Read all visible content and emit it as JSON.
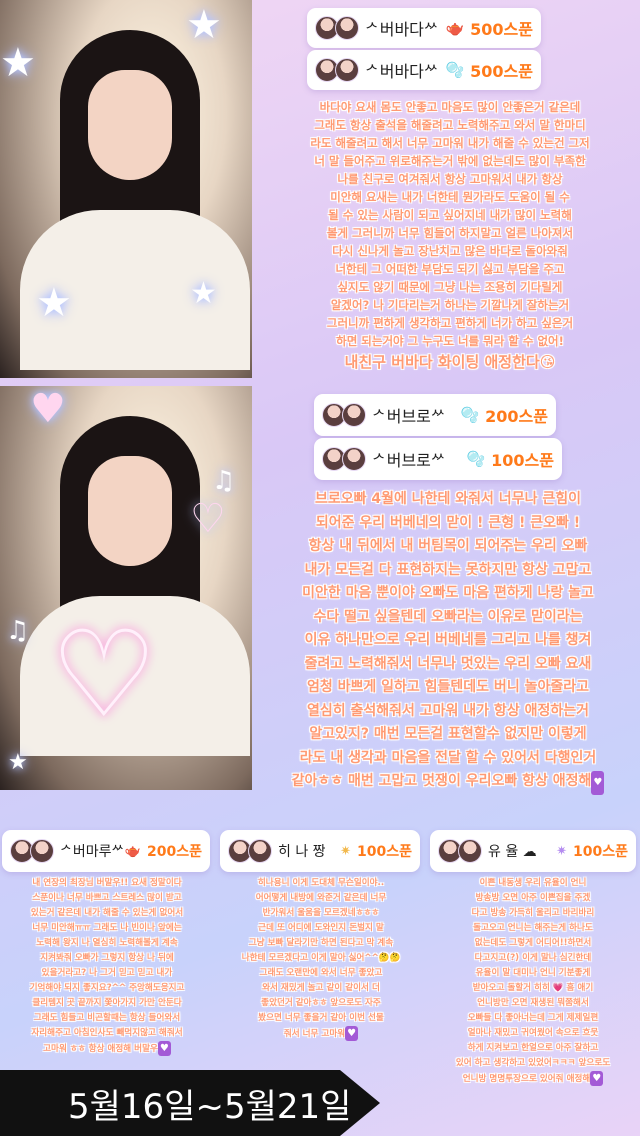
{
  "cards": [
    {
      "name": "ᄼ버바다ᄽ",
      "icon": "🫖",
      "amount": "500스푼"
    },
    {
      "name": "ᄼ버바다ᄽ",
      "icon": "🫧",
      "amount": "500스푼"
    },
    {
      "name": "ᄼ버브로ᄽ",
      "icon": "🫧",
      "amount": "200스푼"
    },
    {
      "name": "ᄼ버브로ᄽ",
      "icon": "🫧",
      "amount": "100스푼"
    },
    {
      "name": "ᄼ버마루ᄽ",
      "icon": "🫖",
      "amount": "200스푼"
    },
    {
      "name": "히 나 짱",
      "icon": "✷",
      "amount": "100스푼"
    },
    {
      "name": "유 율 ☁",
      "icon": "✷",
      "amount": "100스푼"
    }
  ],
  "messages": {
    "bada": [
      "바다야 요새 몸도 안좋고 마음도 많이 안좋은거 같은데",
      "그래도 항상 출석을 해줄려고 노력해주고 와서 말 한마디",
      "라도 해줄려고 해서 너무 고마워 내가 해줄 수 있는건 그저",
      "너 말 들어주고 위로해주는거 밖에 없는데도 많이 부족한",
      "나를 친구로 여겨줘서 항상 고마워서 내가 항상",
      "미안해 요새는 내가 너한테 뭔가라도 도움이 될 수",
      "될 수 있는 사람이 되고 싶어지네 내가 많이 노력해",
      "볼게 그러니까 너무 힘들어 하지말고 얼른 나아져서",
      "다시 신나게 놀고 장난치고 많은 바다로 돌아와줘",
      "너한테 그 어떠한 부담도 되기 싫고 부담을 주고",
      "싶지도 않기 때문에 그냥 나는 조용히 기다릴게",
      "알겠어? 나 기다리는거 하나는 기깔나게 잘하는거",
      "그러니까 편하게 생각하고 편하게 너가 하고 싶은거",
      "하면 되는거야 그 누구도 너를 뭐라 할 수 없어!",
      "내친구 버바다 화이팅 애정한다😘"
    ],
    "bro": [
      "브로오빠 4월에 나한테 와줘서 너무나 큰힘이",
      "되어준 우리 버베네의 맏이 ! 큰형 ! 큰오빠 !",
      "항상 내 뒤에서 내 버팀목이 되어주는 우리 오빠",
      "내가 모든걸 다 표현하지는 못하지만 항상 고맙고",
      "미안한 마음 뿐이야 오빠도 마음 편하게 나랑 놀고",
      "수다 떨고 싶을텐데 오빠라는 이유로 맏이라는",
      "이유 하나만으로 우리 버베네를 그리고 나를 챙겨",
      "줄려고 노력해줘서 너무나 멋있는 우리 오빠 요새",
      "엄청 바쁘게 일하고 힘들텐데도 버니 놀아줄라고",
      "열심히 출석해줘서 고마워 내가 항상 애정하는거",
      "알고있지? 매번 모든걸 표현할수 없지만 이렇게",
      "라도 내 생각과 마음을 전달 할 수 있어서 다행인거",
      "같아ㅎㅎ 매번 고맙고 멋쟁이 우리오빠 항상 애정해"
    ],
    "maru": [
      "내 연장의 최장님 버말우!! 요새 정말이다",
      "스푼이나 너무 바쁘고 스트레스 많이 받고",
      "있는거 같은데 내가 해줄 수 있는게 없어서",
      "너무 미안해ㅠㅠ 그래도 나 빈이나 앞에는",
      "노력해 왕지 나 열심히 노력해볼게 계속",
      "지켜봐줘 오빠가 그렇지 항상 나 뒤에",
      "있을거라고? 나 그거 믿고 믿고 내가",
      "기억해야 되지 좋지요?^^ 주앙해도응지고",
      "클리템지 곳 끝까지 쫓아가지 가만 안둔다",
      "그래도 힘들고 비곤할때는 항상 들어와서",
      "자리해주고 아침인사도 빼먹지않고 해줘서",
      "고마워 ㅎㅎ 항상 애정해 버말우"
    ],
    "hina": [
      "히나용니 이게 도대체 무슨일이야..",
      "어어떻게 내방에 와준거 같은데 너무",
      "반가워서 울움을 모르겠네ㅎㅎㅎ",
      "근데 또 어디에 도와인지 돈벌지 말",
      "그냥 보빠 달라기만 하면 된다고 막 계속",
      "나한테 모르겠다고 이게 말아 싫어^^🤔🤔",
      "그래도 오랜만에 와서 너무 좋았고",
      "와서 재밌게 놀고 같이 같이서 더",
      "좋았던거 같아ㅎㅎ 앞으로도 자주",
      "봤으면 너무 좋을거 같아 이번 선물",
      "줘서 너무 고마워"
    ],
    "yul": [
      "이쁜 내동생 우리 유율이 언니",
      "방송방 오면 아주 이쁜집을 주겠",
      "다고 방송 가득히 울리고 바리바리",
      "돌고오고 언니는 해주는게 하나도",
      "없는데도 그렇게 어디어!!하면서",
      "다고지고(?) 이게 말나 심긴한데",
      "유율이 말 대미나 언니 기분좋게",
      "받아오고 돌할거 히히 💗 흠 애기",
      "언니방만 오면 재생된 뭐쭘해서",
      "오빠들 다 좋아너는데 그게 제제일편",
      "얼마나 재밌고 귀여웠어 속으로 흐뭇",
      "하게 지켜보고 한얼으로 아주 잘하고",
      "있어 하고 생각하고 있었어ㅋㅋㅋ 앞으로도",
      "언니방 명명투장으로 있어줘 애정해"
    ]
  },
  "date_banner": "5월16일~5월21일",
  "colors": {
    "accent": "#ff7a1a",
    "message": "#ff9a73",
    "banner_bg": "#111111"
  }
}
